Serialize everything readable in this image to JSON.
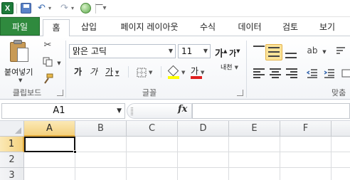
{
  "quick_access": {
    "app_icon_letter": "X",
    "dropdown_glyph": "▾"
  },
  "tabs": {
    "file": "파일",
    "items": [
      "홈",
      "삽입",
      "페이지 레이아웃",
      "수식",
      "데이터",
      "검토",
      "보기"
    ],
    "active": "홈"
  },
  "ribbon": {
    "clipboard": {
      "label": "클립보드",
      "paste_label": "붙여넣기"
    },
    "font": {
      "label": "글꼴",
      "font_name": "맑은 고딕",
      "font_size": "11",
      "grow_glyph": "가",
      "shrink_glyph": "가",
      "bold_glyph": "가",
      "italic_glyph": "가",
      "underline_glyph": "가",
      "font_color_glyph": "가",
      "phonetic_glyph": "내천"
    },
    "alignment": {
      "label": "맞춤",
      "selected_vertical_align": "middle"
    },
    "colors": {
      "file_tab": "#2f8a3e",
      "highlight_yellow": "#ffff00",
      "font_red": "#e02020",
      "selection_header": "#f4d17e"
    }
  },
  "formula_bar": {
    "name_box": "A1",
    "fx_label": "fx",
    "formula_value": ""
  },
  "sheet": {
    "columns": [
      "A",
      "B",
      "C",
      "D",
      "E",
      "F"
    ],
    "rows": [
      "1",
      "2",
      "3"
    ],
    "active_cell": "A1",
    "active_column": "A",
    "active_row": "1"
  }
}
